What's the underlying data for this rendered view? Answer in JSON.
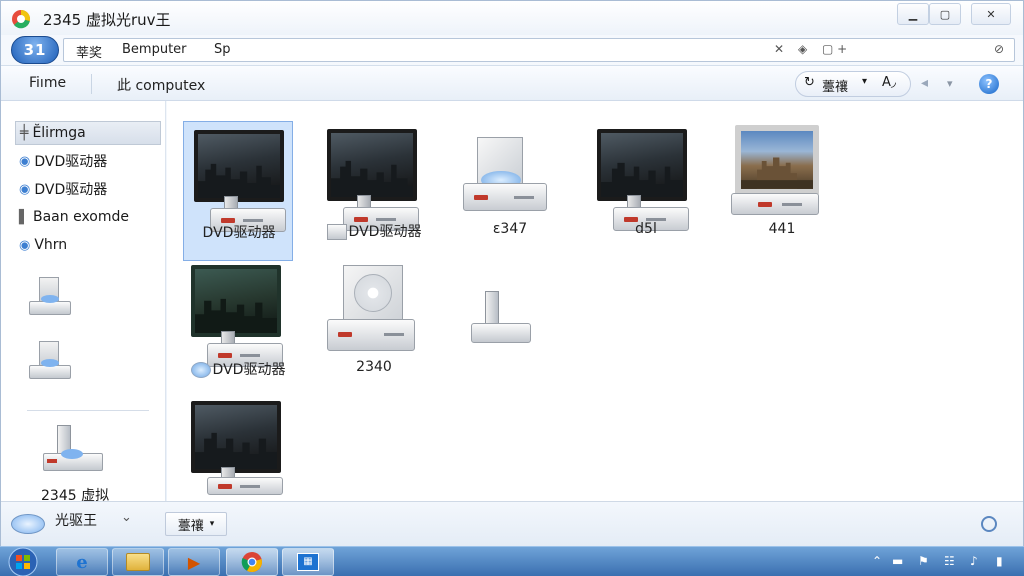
{
  "window": {
    "title": "2345 虚拟光ruv王",
    "min_glyph": "▁",
    "max_glyph": "▢",
    "close_glyph": "✕"
  },
  "address": {
    "nav_label": "31",
    "crumbs": [
      "莘奖",
      "Bemputer",
      "Sp"
    ]
  },
  "command_bar": {
    "file_label": "Fiıme",
    "computer_label": "此 computex",
    "view_label": "薹禳",
    "help_glyph": "?"
  },
  "nav_pane": {
    "items": [
      {
        "label": "Ĕlirmga",
        "icon": "computer-icon"
      },
      {
        "label": "DVD驱动器",
        "icon": "dvd-drive-icon"
      },
      {
        "label": "DVD驱动器",
        "icon": "dvd-drive-icon"
      },
      {
        "label": "Baan exomde",
        "icon": "drive-icon"
      },
      {
        "label": "Vhrn",
        "icon": "dvd-drive-icon"
      }
    ],
    "bottom_item_label": "2345 虚拟\n光驱王",
    "bottom_overlay_label": "光驱王"
  },
  "content": {
    "tiles": [
      {
        "label": "DVD驱动器",
        "kind": "monitor-dark",
        "selected": true
      },
      {
        "label": "DVD驱动器",
        "kind": "monitor-dark",
        "selected": false
      },
      {
        "label": "ɛ347",
        "kind": "cd-drive",
        "selected": false
      },
      {
        "label": "d5l",
        "kind": "monitor-dark",
        "selected": false
      },
      {
        "label": "441",
        "kind": "monitor-photo",
        "selected": false
      },
      {
        "label": "DVD驱动器",
        "kind": "monitor-green",
        "selected": false
      },
      {
        "label": "2340",
        "kind": "cd-box",
        "selected": false
      },
      {
        "label": "",
        "kind": "usb-drive",
        "selected": false
      },
      {
        "label": "",
        "kind": "monitor-dark",
        "selected": false
      }
    ]
  },
  "bottom_bar": {
    "sort_label": "薹禳",
    "chevron_glyph": "⌄"
  },
  "taskbar": {
    "apps": [
      "internet-explorer-icon",
      "folder-icon",
      "media-icon",
      "chrome-icon",
      "virtual-drive-icon"
    ]
  }
}
